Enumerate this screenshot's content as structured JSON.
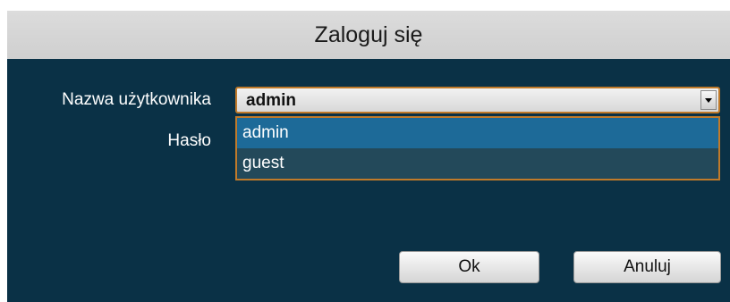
{
  "dialog": {
    "title": "Zaloguj się"
  },
  "form": {
    "username_label": "Nazwa użytkownika",
    "password_label": "Hasło",
    "username_value": "admin",
    "username_options": [
      "admin",
      "guest"
    ],
    "selected_option_index": 0
  },
  "buttons": {
    "ok_label": "Ok",
    "cancel_label": "Anuluj"
  },
  "icons": {
    "dropdown": "chevron-down-icon"
  },
  "colors": {
    "dialog_background": "#0a3146",
    "title_bar": "#d6d6d6",
    "focus_border": "#c07a2a",
    "selected_option": "#1d6a98",
    "option_background": "#23495a"
  }
}
